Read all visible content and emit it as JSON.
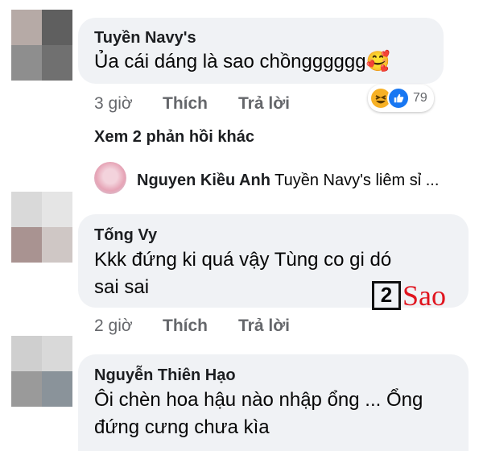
{
  "comments": [
    {
      "author": "Tuyền Navy's",
      "text_lines": [
        "Ủa cái dáng là sao chồngggggg"
      ],
      "emoji": "🥰",
      "time": "3 giờ",
      "like_label": "Thích",
      "reply_label": "Trả lời",
      "reaction_count": "79",
      "avatar_colors": [
        "#b6aaa6",
        "#5f5f5f",
        "#8e8e8e",
        "#707070"
      ]
    },
    {
      "author": "Tống Vy",
      "text_lines": [
        "Kkk đứng ki quá vậy Tùng co gi dó",
        "sai sai"
      ],
      "time": "2 giờ",
      "like_label": "Thích",
      "reply_label": "Trả lời",
      "avatar_colors": [
        "#d9d9d9",
        "#e5e5e5",
        "#a99391",
        "#cfc7c5"
      ]
    },
    {
      "author": "Nguyễn Thiên Hạo",
      "text_lines": [
        "Ôi chèn hoa hậu nào nhập ổng ... Ổng",
        "đứng cưng chưa kìa"
      ],
      "avatar_colors": [
        "#cfcfcf",
        "#d9d9d9",
        "#9a9a9a",
        "#8a939a"
      ]
    }
  ],
  "more_replies": {
    "label": "Xem 2 phản hồi khác",
    "reply_author": "Nguyen Kiều Anh",
    "reply_preview": "Tuyền Navy's liêm sỉ ..."
  },
  "watermark": {
    "number": "2",
    "text": "Sao",
    "accent": "#e0141e"
  },
  "colors": {
    "bubble": "#f0f2f5",
    "meta": "#65676b",
    "like_blue": "#1877f2",
    "haha_yellow": "#f7b125"
  },
  "icons": [
    "haha-reaction-icon",
    "like-reaction-icon",
    "reply-avatar"
  ]
}
